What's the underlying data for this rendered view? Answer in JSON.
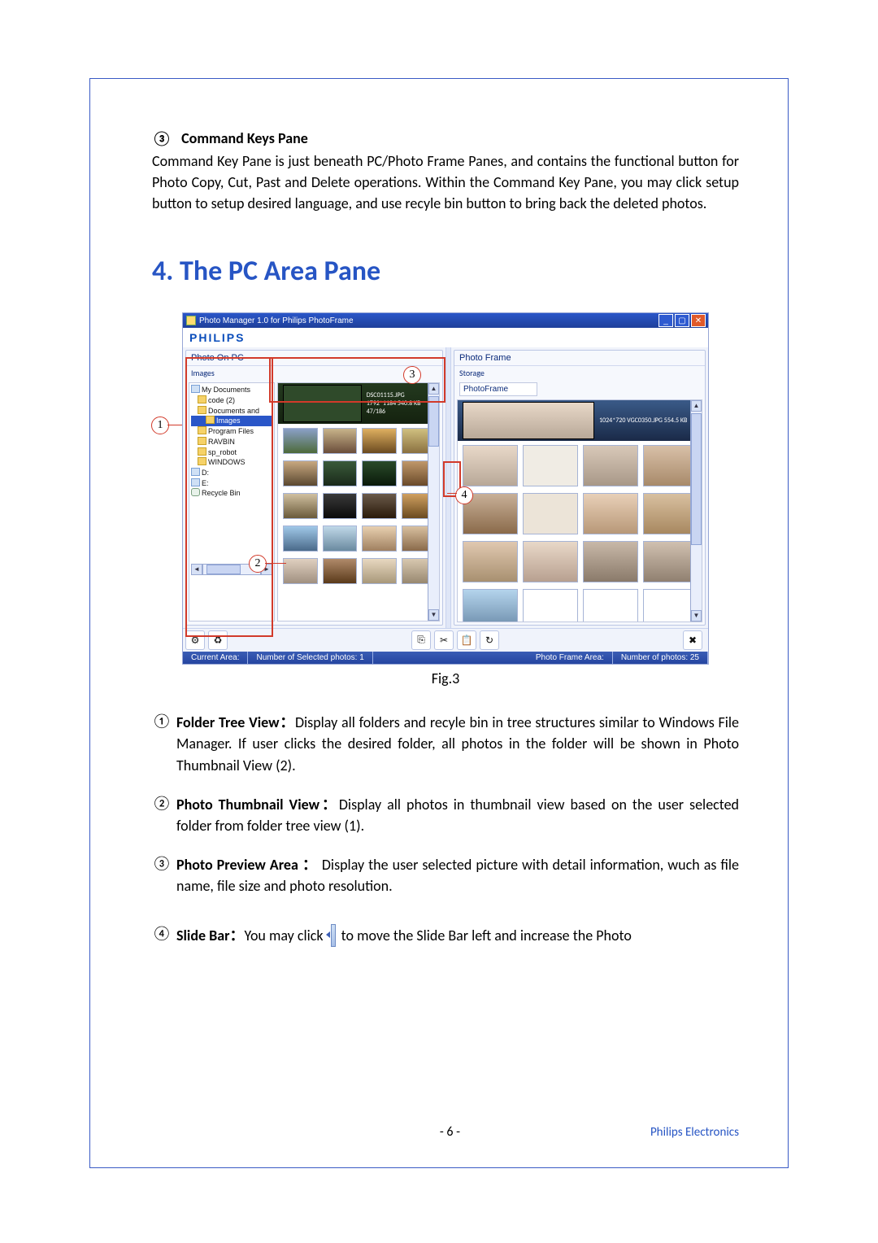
{
  "section3": {
    "num": "③",
    "title": "Command Keys Pane",
    "body": "Command Key Pane is just beneath PC/Photo Frame Panes, and contains the functional button for Photo Copy, Cut, Past and Delete operations. Within the Command Key Pane, you may click setup button to setup desired language, and use recyle bin button to bring back the deleted photos."
  },
  "heading": "4. The PC Area Pane",
  "fig_caption": "Fig.3",
  "app": {
    "title": "Photo Manager 1.0 for Philips PhotoFrame",
    "logo": "PHILIPS",
    "pc_head": "Photo On PC",
    "pc_sub": "Images",
    "frame_head": "Photo Frame",
    "frame_sub": "Storage",
    "device": "PhotoFrame",
    "preview_pc": "DSC01115.JPG  1792*1184  540.8 KB  47/186",
    "preview_frame": "1024*720  VGC0350.JPG  554.5 KB",
    "tree": {
      "root": "My Documents",
      "n0": "code (2)",
      "n1": "Documents and",
      "n1a": "Images",
      "n2": "Program Files",
      "n3": "RAVBIN",
      "n4": "sp_robot",
      "n5": "WINDOWS",
      "d1": "D:",
      "d2": "E:",
      "rb": "Recycle Bin"
    },
    "status": {
      "s1": "Current Area:",
      "s2": "Number of Selected photos: 1",
      "s3": "Photo Frame Area:",
      "s4": "Number of photos: 25"
    }
  },
  "callouts": {
    "c1": "1",
    "c2": "2",
    "c3": "3",
    "c4": "4"
  },
  "items": {
    "i1": {
      "num": "①",
      "bold": "Folder Tree View",
      "colon": "：",
      "text": "Display all folders and recyle bin in tree structures similar to Windows File Manager. If user clicks the desired folder, all photos in the folder will be shown in Photo Thumbnail View (2)."
    },
    "i2": {
      "num": "②",
      "bold": "Photo Thumbnail View",
      "colon": "：",
      "text": "Display all photos in thumbnail view based on the user selected folder from folder tree view (1)."
    },
    "i3": {
      "num": "③",
      "bold": "Photo Preview Area",
      "colon": " ：  ",
      "text": "Display the user selected picture with detail information, wuch as file name, file size and photo resolution."
    },
    "i4": {
      "num": "④",
      "bold": "Slide Bar",
      "colon": "：",
      "pre": "You may click ",
      "post": " to move the Slide Bar left and increase the Photo"
    }
  },
  "footer": {
    "page": "- 6 -",
    "brand": "Philips Electronics"
  }
}
